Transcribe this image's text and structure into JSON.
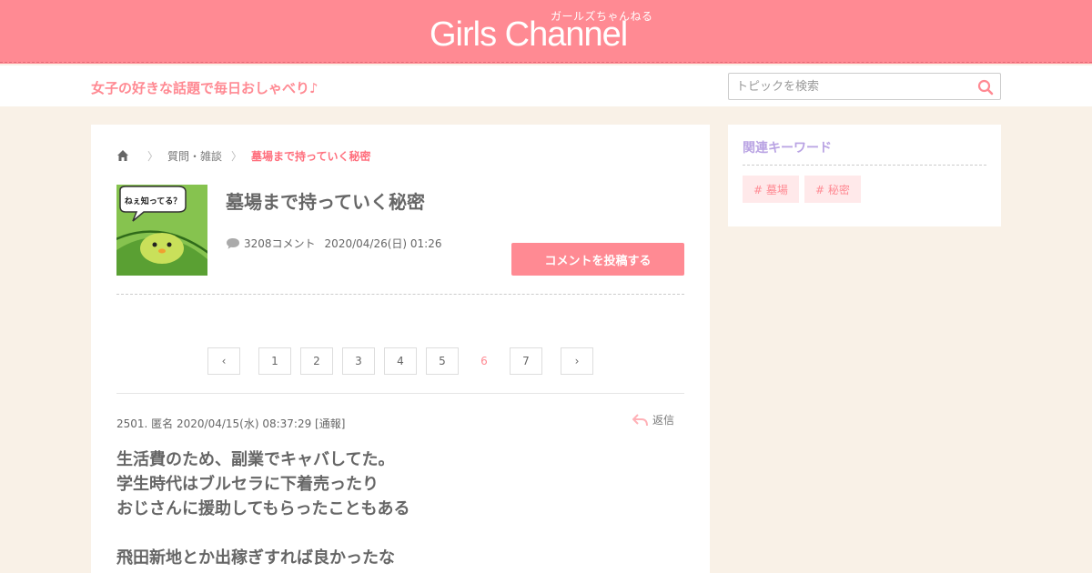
{
  "header": {
    "logo_sub": "ガールズちゃんねる",
    "logo_main": "Girls Channel",
    "tagline": "女子の好きな話題で毎日おしゃべり♪",
    "search_placeholder": "トピックを検索"
  },
  "breadcrumb": {
    "category": "質問・雑談",
    "current": "墓場まで持っていく秘密"
  },
  "topic": {
    "title": "墓場まで持っていく秘密",
    "thumb_text": "ねぇ知ってる？",
    "comment_count": "3208コメント",
    "date": "2020/04/26(日) 01:26",
    "post_button": "コメントを投稿する"
  },
  "pagination": {
    "prev": "‹",
    "next": "›",
    "pages": [
      "1",
      "2",
      "3",
      "4",
      "5",
      "6",
      "7"
    ],
    "current": "6"
  },
  "comment": {
    "header": "2501. 匿名 2020/04/15(水) 08:37:29 [通報]",
    "reply_label": "返信",
    "lines": [
      "生活費のため、副業でキャバしてた。",
      "学生時代はブルセラに下着売ったり",
      "おじさんに援助してもらったこともある",
      "",
      "飛田新地とか出稼ぎすれば良かったな"
    ]
  },
  "sidebar": {
    "title": "関連キーワード",
    "keywords": [
      "# 墓場",
      "# 秘密"
    ]
  },
  "colors": {
    "brand": "#ff8a93",
    "background": "#f9f1e7",
    "sidebar_title": "#b9a3e3",
    "keyword_bg": "#ffe9ea"
  }
}
